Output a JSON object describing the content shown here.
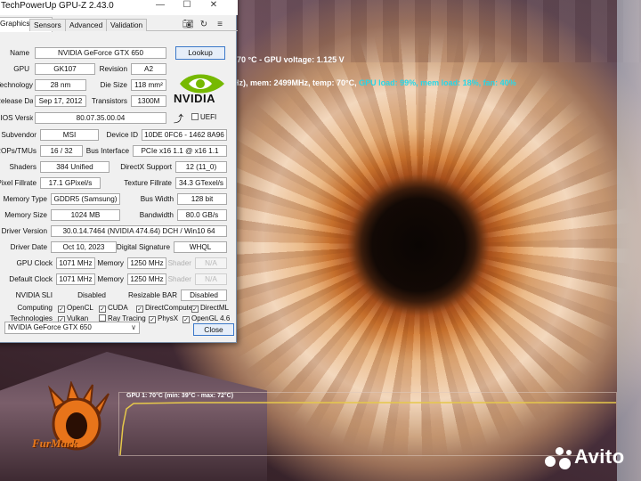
{
  "window": {
    "title": "TechPowerUp GPU-Z 2.43.0",
    "minimize": "—",
    "maximize": "☐",
    "close": "✕"
  },
  "tabs": [
    "Graphics Card",
    "Sensors",
    "Advanced",
    "Validation"
  ],
  "toolbar": {
    "camera_icon": "camera-icon",
    "refresh_icon": "refresh-icon",
    "menu_icon": "menu-icon"
  },
  "fields": {
    "name_label": "Name",
    "name": "NVIDIA GeForce GTX 650",
    "lookup": "Lookup",
    "gpu_label": "GPU",
    "gpu": "GK107",
    "revision_label": "Revision",
    "revision": "A2",
    "technology_label": "Technology",
    "technology": "28 nm",
    "die_size_label": "Die Size",
    "die_size": "118 mm²",
    "release_label": "Release Date",
    "release": "Sep 17, 2012",
    "transistors_label": "Transistors",
    "transistors": "1300M",
    "bios_label": "BIOS Version",
    "bios": "80.07.35.00.04",
    "uefi_label": "UEFI",
    "subvendor_label": "Subvendor",
    "subvendor": "MSI",
    "device_id_label": "Device ID",
    "device_id": "10DE 0FC6 - 1462 8A96",
    "rops_label": "ROPs/TMUs",
    "rops": "16 / 32",
    "bus_label": "Bus Interface",
    "bus": "PCIe x16 1.1 @ x16 1.1",
    "shaders_label": "Shaders",
    "shaders": "384 Unified",
    "directx_label": "DirectX Support",
    "directx": "12 (11_0)",
    "pixel_label": "Pixel Fillrate",
    "pixel": "17.1 GPixel/s",
    "texture_label": "Texture Fillrate",
    "texture": "34.3 GTexel/s",
    "memtype_label": "Memory Type",
    "memtype": "GDDR5 (Samsung)",
    "buswidth_label": "Bus Width",
    "buswidth": "128 bit",
    "memsize_label": "Memory Size",
    "memsize": "1024 MB",
    "bandwidth_label": "Bandwidth",
    "bandwidth": "80.0 GB/s",
    "driver_label": "Driver Version",
    "driver": "30.0.14.7464 (NVIDIA 474.64) DCH / Win10 64",
    "driverdate_label": "Driver Date",
    "driverdate": "Oct 10, 2023",
    "signature_label": "Digital Signature",
    "signature": "WHQL",
    "gpuclock_label": "GPU Clock",
    "gpuclock": "1071 MHz",
    "memory_label": "Memory",
    "memclock": "1250 MHz",
    "shader_label": "Shader",
    "shader": "N/A",
    "defclock_label": "Default Clock",
    "defclock": "1071 MHz",
    "defmem": "1250 MHz",
    "defshader": "N/A",
    "sli_label": "NVIDIA SLI",
    "sli": "Disabled",
    "bar_label": "Resizable BAR",
    "bar": "Disabled",
    "computing_label": "Computing",
    "technologies_label": "Technologies"
  },
  "computing": [
    {
      "label": "OpenCL",
      "checked": true
    },
    {
      "label": "CUDA",
      "checked": true
    },
    {
      "label": "DirectCompute",
      "checked": true
    },
    {
      "label": "DirectML",
      "checked": true
    }
  ],
  "technologies": [
    {
      "label": "Vulkan",
      "checked": true
    },
    {
      "label": "Ray Tracing",
      "checked": false
    },
    {
      "label": "PhysX",
      "checked": true
    },
    {
      "label": "OpenGL 4.6",
      "checked": true
    }
  ],
  "vendor_logo": "NVIDIA",
  "gpu_select": "NVIDIA GeForce GTX 650",
  "close_button": "Close",
  "osd": {
    "line1": "70 °C - GPU voltage: 1.125 V",
    "line2_a": "Hz), mem: 2499MHz, temp: 70°C, ",
    "line2_b": "GPU load: 99%, mem load: 18%, fan: 40%"
  },
  "graph": {
    "label": "GPU 1: 70°C (min: 39°C - max: 72°C)",
    "color": "#e6c84a"
  },
  "furmark_logo": "FurMark",
  "watermark": "Avito",
  "colors": {
    "nvidia_green": "#76b900",
    "osd_cyan": "#29d7e6",
    "accent_blue": "#3b78c9"
  }
}
